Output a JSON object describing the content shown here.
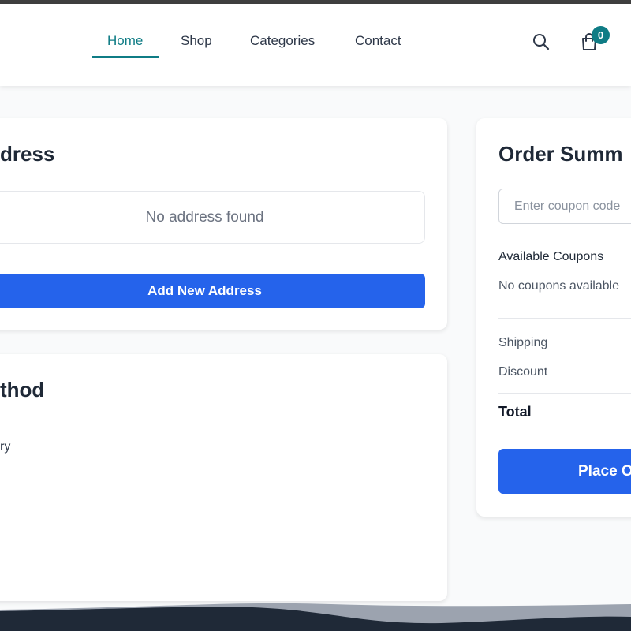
{
  "nav": {
    "items": [
      {
        "label": "Home",
        "active": true
      },
      {
        "label": "Shop",
        "active": false
      },
      {
        "label": "Categories",
        "active": false
      },
      {
        "label": "Contact",
        "active": false
      }
    ],
    "search_icon": "search-icon",
    "cart_icon": "shopping-bag-icon",
    "cart_count": "0"
  },
  "address": {
    "title": "dress",
    "empty_text": "No address found",
    "add_button": "Add New Address"
  },
  "payment": {
    "title": "thod",
    "option_text": "ry"
  },
  "summary": {
    "title": "Order Summ",
    "coupon_placeholder": "Enter coupon code",
    "available_label": "Available Coupons",
    "no_coupons": "No coupons available",
    "shipping_label": "Shipping",
    "discount_label": "Discount",
    "total_label": "Total",
    "place_button": "Place O"
  },
  "colors": {
    "accent": "#0f7c85",
    "primary": "#2563eb",
    "footer": "#1f2937"
  }
}
